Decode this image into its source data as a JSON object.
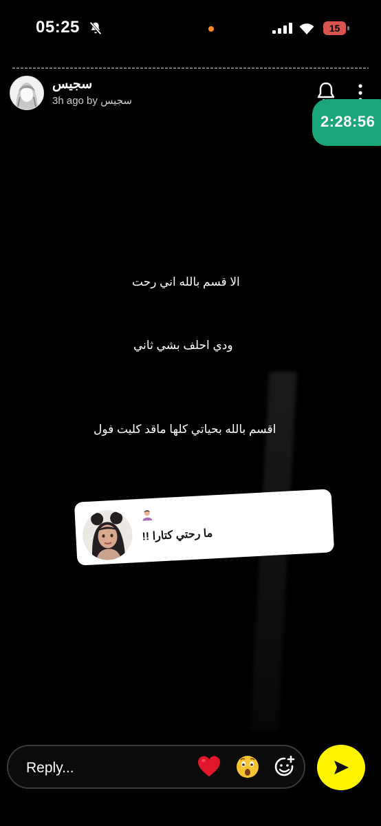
{
  "status_bar": {
    "time": "05:25",
    "battery_level": "15",
    "icons": [
      "bell-muted-icon",
      "orange-dot-icon",
      "signal-icon",
      "wifi-icon",
      "battery-icon"
    ]
  },
  "header": {
    "username": "سجيس",
    "meta": "3h ago by سجيس",
    "timer": "2:28:56",
    "icons": [
      "bell-icon",
      "more-vertical-icon"
    ]
  },
  "story": {
    "lines": [
      "الا قسم بالله اني رحت",
      "ودي احلف بشي ثاني",
      "اقسم بالله بحياتي كلها ماقد كليت فول"
    ]
  },
  "quote_card": {
    "text": "ما رحتي كتارا !!",
    "emoji": "woman-gesturing-emoji"
  },
  "reply_bar": {
    "placeholder": "Reply...",
    "reactions": [
      "heart-icon",
      "astonished-face-icon",
      "add-sticker-icon"
    ],
    "send_icon": "send-arrow-icon"
  },
  "colors": {
    "timer_badge": "#1aa57a",
    "send_button": "#fef400",
    "battery": "#d9534f",
    "heart": "#e0162b"
  }
}
